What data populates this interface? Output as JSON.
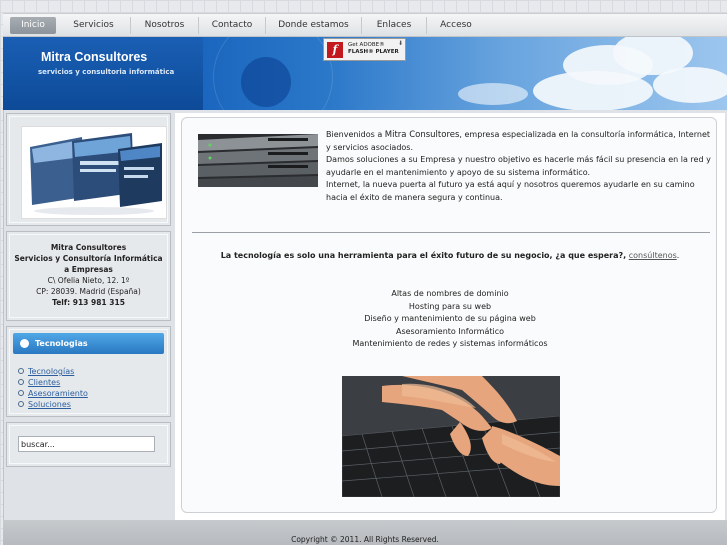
{
  "nav": {
    "items": [
      {
        "label": "Inicio",
        "active": true
      },
      {
        "label": "Servicios"
      },
      {
        "label": "Nosotros"
      },
      {
        "label": "Contacto"
      },
      {
        "label": "Donde estamos"
      },
      {
        "label": "Enlaces"
      },
      {
        "label": "Acceso"
      }
    ]
  },
  "header": {
    "title": "Mitra Consultores",
    "subtitle": "servicios y consultoria informática",
    "flash": {
      "line1": "Get ADOBE®",
      "line2": "FLASH® PLAYER",
      "icon": "flash-logo-icon"
    }
  },
  "sidebar": {
    "address": {
      "name": "Mitra Consultores",
      "tagline": "Servicios y Consultoría Informática a Empresas",
      "street": "C\\ Ofelia Nieto, 12. 1º",
      "city": "CP: 28039. Madrid (España)",
      "phone": "Telf: 913 981 315"
    },
    "tech": {
      "heading": "Tecnologias",
      "links": [
        "Tecnologías",
        "Clientes",
        "Asesoramiento",
        "Soluciones"
      ]
    },
    "search": {
      "value": "buscar..."
    }
  },
  "main": {
    "intro": [
      "Bienvenidos a ",
      "Mitra Consultores",
      ", empresa especializada en la consultoría informática, Internet y servicios asociados.",
      "Damos soluciones a su Empresa y nuestro objetivo es hacerle más fácil su presencia en la red y ayudarle en el mantenimiento y apoyo de su sistema informático.",
      "Internet, la nueva puerta al futuro ya está aquí y nosotros queremos ayudarle en su camino hacia el éxito de manera segura y continua."
    ],
    "tagline": "La tecnología es solo una herramienta para el éxito futuro de su negocio,  ¿a que espera?,",
    "tagline_link": "consúltenos",
    "tagline_end": ".",
    "services": [
      "Altas de nombres de dominio",
      "Hosting para su web",
      "Diseño y mantenimiento de su página web",
      "Asesoramiento Informático",
      "Mantenimiento de redes y sistemas informáticos"
    ]
  },
  "footer": {
    "text": "Copyright © 2011. All Rights Reserved."
  },
  "colors": {
    "accent": "#2a78c2",
    "banner": "#1b67bf"
  }
}
